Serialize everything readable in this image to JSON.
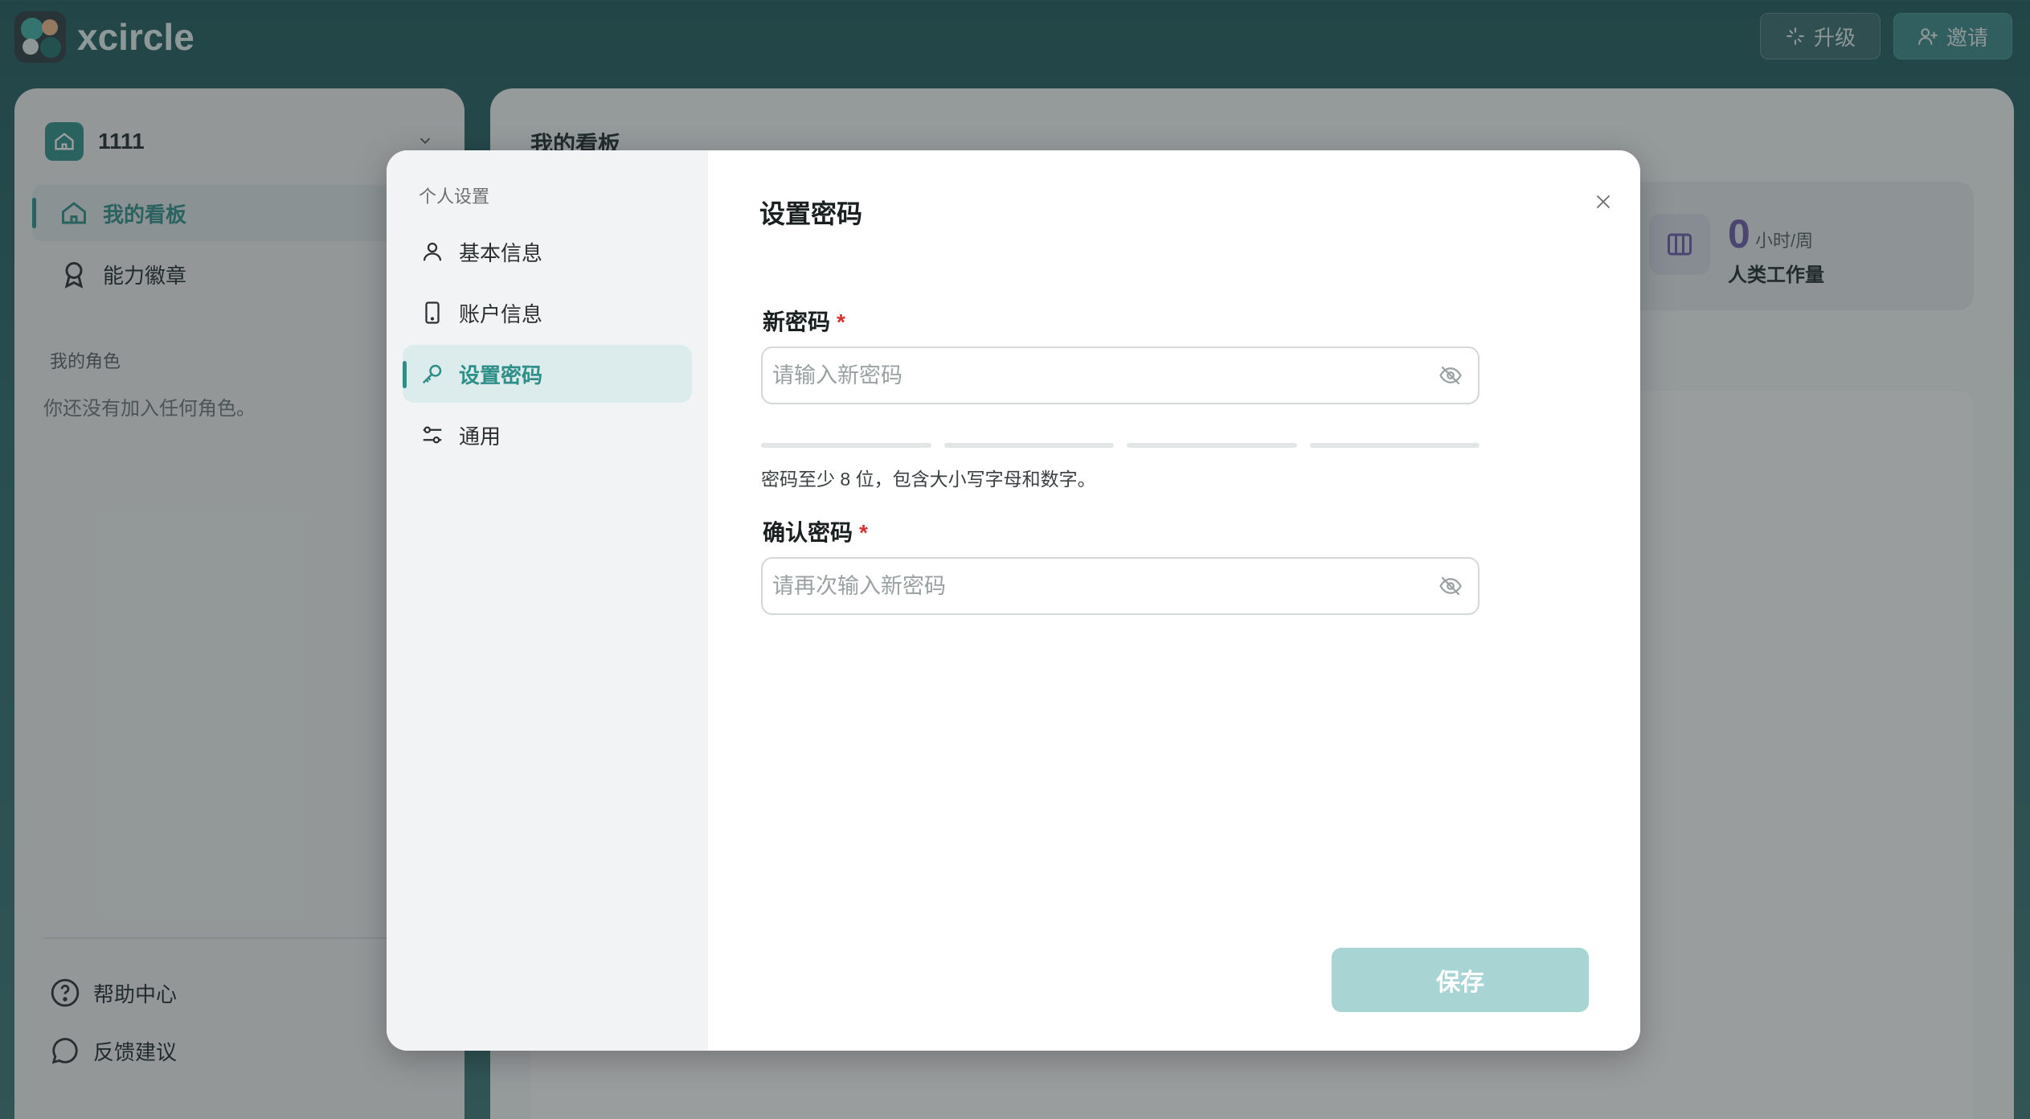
{
  "app": {
    "name": "xcircle"
  },
  "topbar": {
    "upgrade_label": "升级",
    "invite_label": "邀请"
  },
  "sidebar": {
    "workspace_name": "1111",
    "items": [
      {
        "label": "我的看板",
        "active": true
      },
      {
        "label": "能力徽章",
        "active": false
      }
    ],
    "roles_section_title": "我的角色",
    "roles_empty": "你还没有加入任何角色。",
    "footer": [
      {
        "label": "帮助中心"
      },
      {
        "label": "反馈建议"
      }
    ]
  },
  "main": {
    "title": "我的看板",
    "stat": {
      "value": "0",
      "unit": "小时/周",
      "label": "人类工作量"
    }
  },
  "modal": {
    "section_title": "个人设置",
    "menu": [
      {
        "label": "基本信息",
        "icon": "user-icon",
        "active": false
      },
      {
        "label": "账户信息",
        "icon": "phone-icon",
        "active": false
      },
      {
        "label": "设置密码",
        "icon": "key-icon",
        "active": true
      },
      {
        "label": "通用",
        "icon": "settings-sliders-icon",
        "active": false
      }
    ],
    "title": "设置密码",
    "new_password": {
      "label": "新密码",
      "required_mark": "*",
      "placeholder": "请输入新密码",
      "value": "",
      "strength_level": 0
    },
    "hint": "密码至少 8 位，包含大小写字母和数字。",
    "confirm_password": {
      "label": "确认密码",
      "required_mark": "*",
      "placeholder": "请再次输入新密码",
      "value": ""
    },
    "save_label": "保存"
  },
  "colors": {
    "accent": "#2e8f88",
    "save_disabled": "#a8d4d4",
    "required": "#d93030"
  }
}
